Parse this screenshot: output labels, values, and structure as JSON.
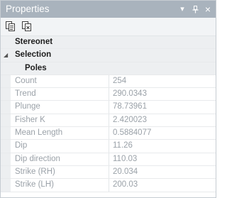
{
  "window": {
    "title": "Properties"
  },
  "titlebar_buttons": {
    "dropdown": "▾",
    "pin": "pin-icon",
    "close": "×"
  },
  "toolbar": {
    "tools": [
      "copy-icon",
      "copy-values-icon"
    ]
  },
  "categories": {
    "stereonet": "Stereonet",
    "selection": "Selection",
    "poles": "Poles"
  },
  "properties": [
    {
      "name": "Count",
      "value": "254"
    },
    {
      "name": "Trend",
      "value": "290.0343"
    },
    {
      "name": "Plunge",
      "value": "78.73961"
    },
    {
      "name": "Fisher K",
      "value": "2.420023"
    },
    {
      "name": "Mean Length",
      "value": "0.5884077"
    },
    {
      "name": "Dip",
      "value": "11.26"
    },
    {
      "name": "Dip direction",
      "value": "110.03"
    },
    {
      "name": "Strike (RH)",
      "value": "20.034"
    },
    {
      "name": "Strike (LH)",
      "value": "200.03"
    }
  ]
}
